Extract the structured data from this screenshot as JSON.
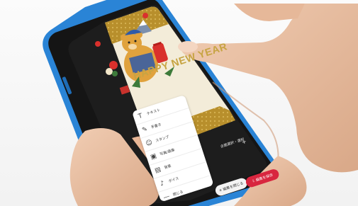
{
  "card": {
    "greeting": "HAPPY NEW YEAR"
  },
  "editor_menu": {
    "items": [
      {
        "icon": "text-icon",
        "glyph": "T",
        "label": "テキスト"
      },
      {
        "icon": "handwriting-icon",
        "glyph": "✎",
        "label": "手書き"
      },
      {
        "icon": "stamp-icon",
        "glyph": "☺",
        "label": "スタンプ"
      },
      {
        "icon": "photo-icon",
        "glyph": "▣",
        "label": "写真/画像"
      },
      {
        "icon": "background-icon",
        "glyph": "▤",
        "label": "背景"
      },
      {
        "icon": "voice-icon",
        "glyph": "♪",
        "label": "ボイス"
      },
      {
        "icon": "close-icon",
        "glyph": "—",
        "label": "閉じる"
      }
    ]
  },
  "toolbar": {
    "select_label": "全面選択・選択",
    "plus_glyph": "+",
    "secondary_button": "✕ 編集を閉じる",
    "primary_button": "⇩ 編集を保存"
  },
  "colors": {
    "phone_frame": "#2a84d6",
    "phone_screen": "#1a1a1a",
    "card_gold": "#c7a443",
    "card_background": "#f3ecd9",
    "accent_red": "#d8263f"
  }
}
